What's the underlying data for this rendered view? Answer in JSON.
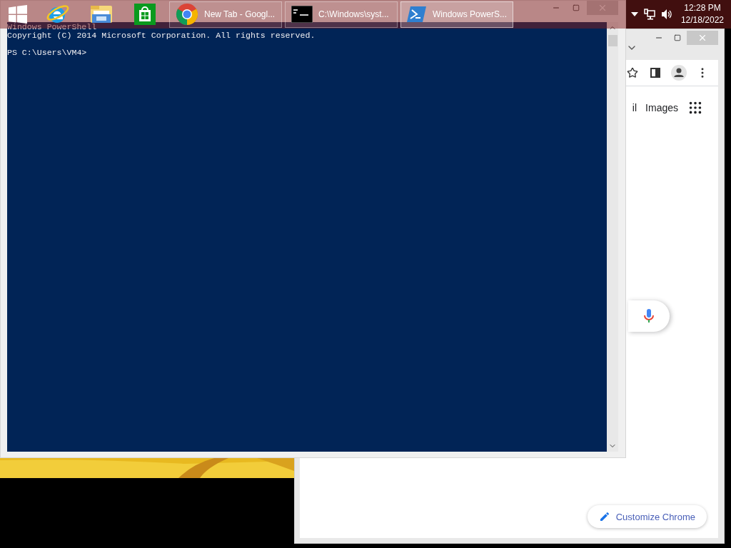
{
  "taskbar": {
    "pinned": [
      {
        "kind": "start"
      },
      {
        "kind": "browser-e"
      },
      {
        "kind": "folder"
      },
      {
        "kind": "store"
      }
    ],
    "tasks": [
      {
        "kind": "chrome",
        "label": "New Tab - Googl...",
        "selected": false
      },
      {
        "kind": "console",
        "label": "C:\\Windows\\syst...",
        "selected": false
      },
      {
        "kind": "powershell",
        "label": "Windows PowerS...",
        "selected": true
      }
    ],
    "tray": {
      "time": "12:28 PM",
      "date": "12/18/2022"
    }
  },
  "powershell": {
    "banner": [
      "Windows PowerShell",
      "Copyright (C) 2014 Microsoft Corporation. All rights reserved."
    ],
    "prompt": "PS C:\\Users\\VM4>"
  },
  "chrome": {
    "nav_links": [
      "il",
      "Images"
    ],
    "customize_button": "Customize Chrome"
  }
}
